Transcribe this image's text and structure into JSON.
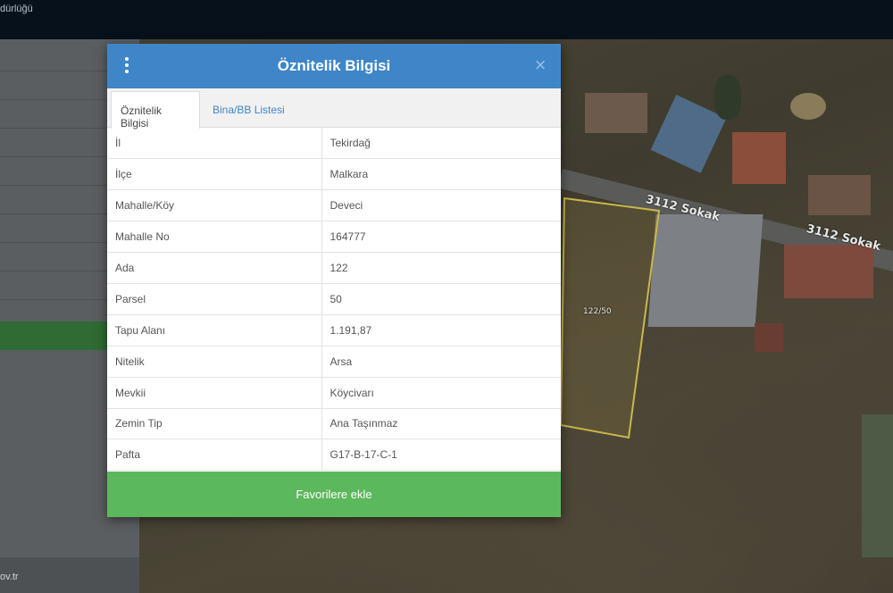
{
  "topbar": {
    "title": "dürlüğü"
  },
  "left_panel": {
    "footer_link": "ov.tr"
  },
  "map": {
    "street_labels": [
      "3112 Sokak",
      "3112 Sokak"
    ],
    "parcel_label": "122/50"
  },
  "modal": {
    "title": "Öznitelik Bilgisi",
    "close_symbol": "×",
    "menu_icon": "vertical-dots-icon",
    "tabs": [
      {
        "label": "Öznitelik Bilgisi",
        "active": true
      },
      {
        "label": "Bina/BB Listesi",
        "active": false
      }
    ],
    "rows": [
      {
        "key": "İl",
        "value": "Tekirdağ"
      },
      {
        "key": "İlçe",
        "value": "Malkara"
      },
      {
        "key": "Mahalle/Köy",
        "value": "Deveci"
      },
      {
        "key": "Mahalle No",
        "value": "164777"
      },
      {
        "key": "Ada",
        "value": "122"
      },
      {
        "key": "Parsel",
        "value": "50"
      },
      {
        "key": "Tapu Alanı",
        "value": "1.191,87"
      },
      {
        "key": "Nitelik",
        "value": "Arsa"
      },
      {
        "key": "Mevkii",
        "value": "Köycivarı"
      },
      {
        "key": "Zemin Tip",
        "value": "Ana Taşınmaz"
      },
      {
        "key": "Pafta",
        "value": "G17-B-17-C-1"
      }
    ],
    "favorites_button": "Favorilere ekle"
  },
  "colors": {
    "header_blue": "#3e86c8",
    "button_green": "#5cb85c",
    "topbar": "#07111c",
    "parcel_outline": "#c9b84a"
  }
}
